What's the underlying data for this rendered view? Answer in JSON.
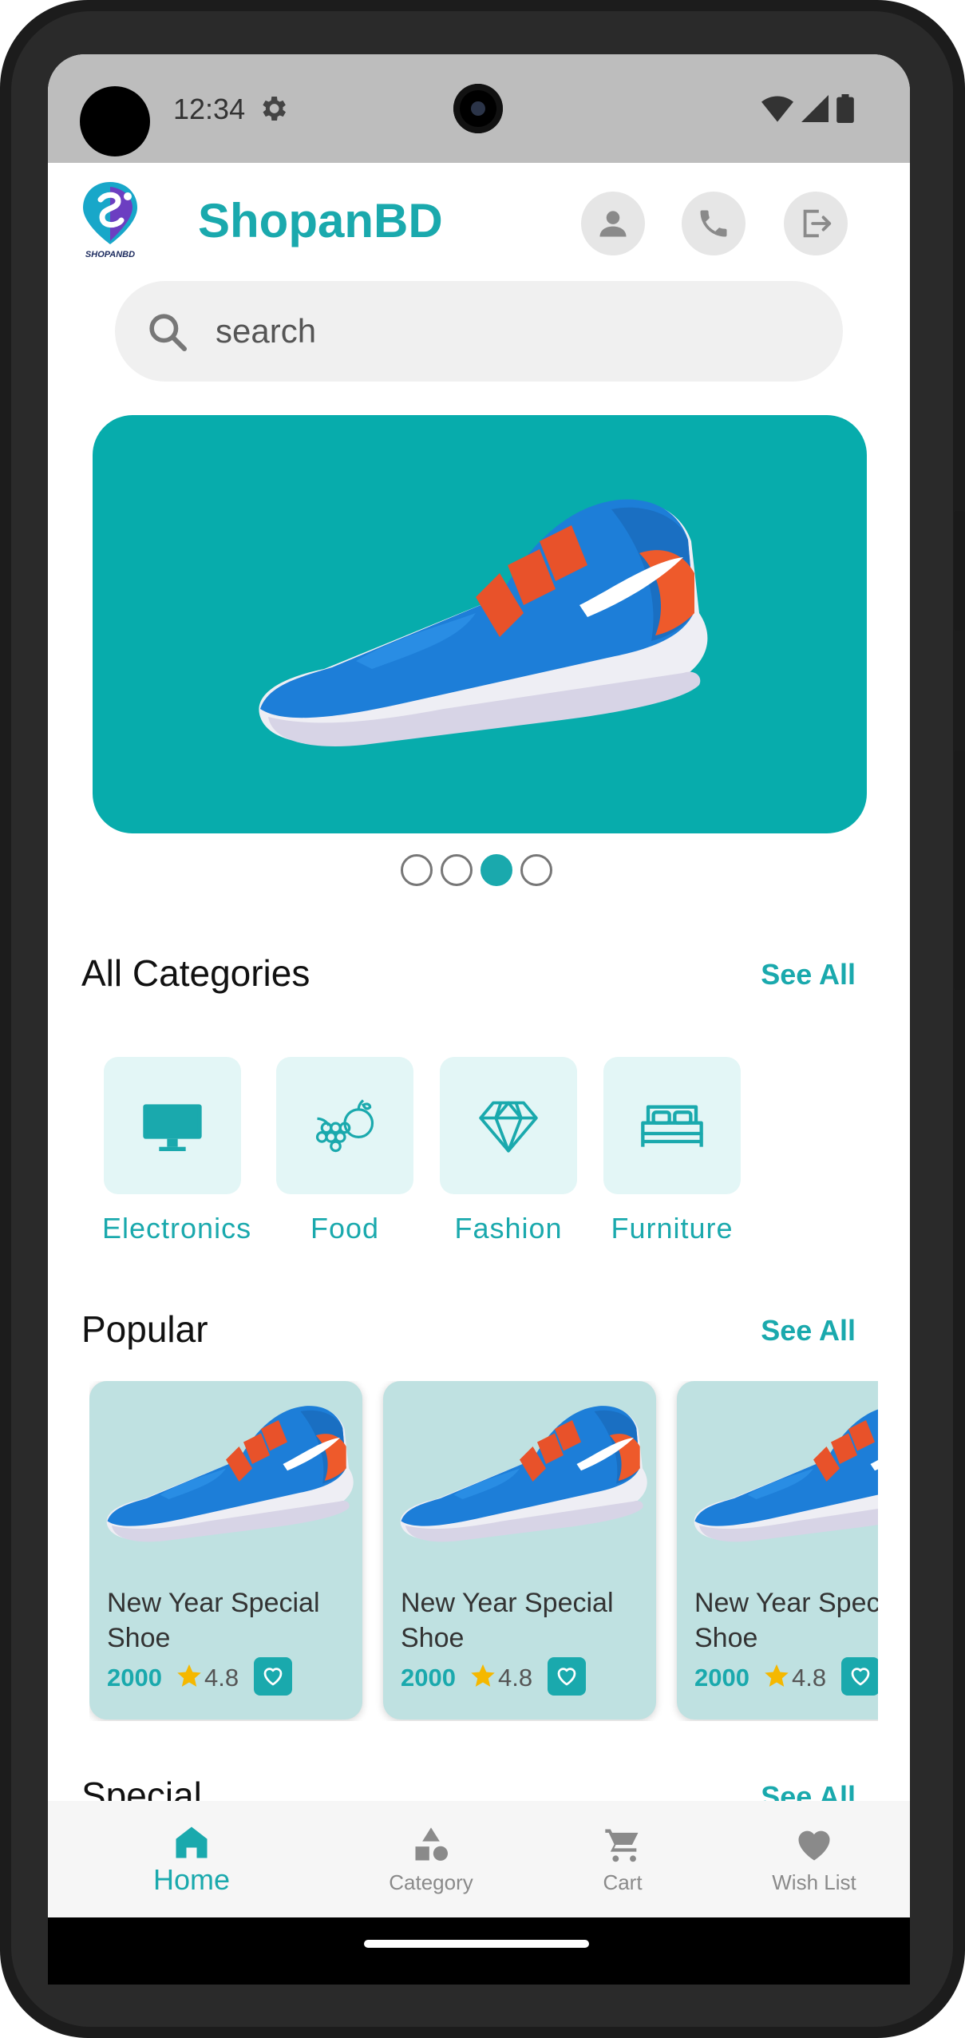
{
  "status_bar": {
    "time": "12:34"
  },
  "header": {
    "brand": "ShopanBD",
    "logo_text": "SHOPANBD"
  },
  "search": {
    "placeholder": "search"
  },
  "banner": {
    "slide_count": 4,
    "active_slide": 3
  },
  "categories": {
    "title": "All Categories",
    "see_all": "See All",
    "items": [
      {
        "label": "Electronics",
        "icon": "monitor-icon"
      },
      {
        "label": "Food",
        "icon": "fruits-icon"
      },
      {
        "label": "Fashion",
        "icon": "diamond-icon"
      },
      {
        "label": "Furniture",
        "icon": "bed-icon"
      }
    ]
  },
  "popular": {
    "title": "Popular",
    "see_all": "See All",
    "products": [
      {
        "name": "New Year Special Shoe",
        "price": "2000",
        "rating": "4.8"
      },
      {
        "name": "New Year Special Shoe",
        "price": "2000",
        "rating": "4.8"
      },
      {
        "name": "New Year Special Shoe",
        "price": "2000",
        "rating": "4.8"
      }
    ]
  },
  "special": {
    "title": "Special",
    "see_all": "See All"
  },
  "bottom_nav": {
    "items": [
      {
        "label": "Home",
        "icon": "home-icon",
        "active": true
      },
      {
        "label": "Category",
        "icon": "category-icon",
        "active": false
      },
      {
        "label": "Cart",
        "icon": "cart-icon",
        "active": false
      },
      {
        "label": "Wish List",
        "icon": "heart-icon",
        "active": false
      }
    ]
  },
  "colors": {
    "accent": "#1aa9ad",
    "banner_bg": "#07acac",
    "card_bg": "#bfe1e1",
    "category_bg": "#e3f6f6"
  }
}
